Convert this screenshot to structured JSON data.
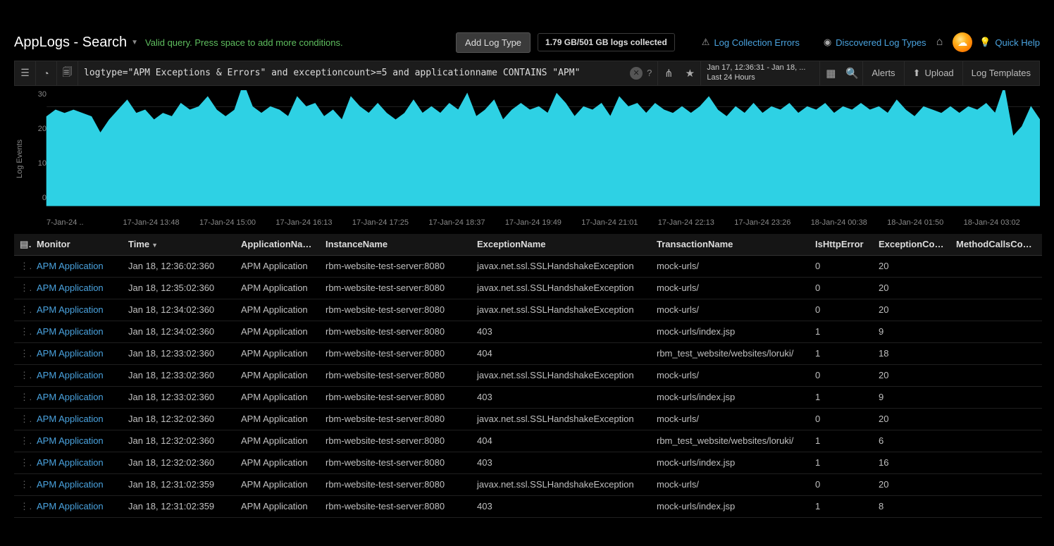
{
  "header": {
    "title": "AppLogs - Search",
    "query_hint": "Valid query. Press space to add more conditions.",
    "add_log_type": "Add Log Type",
    "logs_collected": "1.79 GB/501 GB logs collected",
    "links": {
      "collection_errors": "Log Collection Errors",
      "discovered_types": "Discovered Log Types",
      "quick_help": "Quick Help"
    }
  },
  "querybar": {
    "query": "logtype=\"APM Exceptions & Errors\" and exceptioncount>=5 and applicationname CONTAINS \"APM\"",
    "daterange_line1": "Jan 17, 12:36:31 - Jan 18, ...",
    "daterange_line2": "Last 24 Hours",
    "alerts": "Alerts",
    "upload": "Upload",
    "templates": "Log Templates"
  },
  "chart_data": {
    "type": "area",
    "ylabel": "Log Events",
    "ylim": [
      0,
      35
    ],
    "yticks": [
      30,
      20,
      10,
      0
    ],
    "xticks": [
      "7-Jan-24 ..",
      "17-Jan-24 13:48",
      "17-Jan-24 15:00",
      "17-Jan-24 16:13",
      "17-Jan-24 17:25",
      "17-Jan-24 18:37",
      "17-Jan-24 19:49",
      "17-Jan-24 21:01",
      "17-Jan-24 22:13",
      "17-Jan-24 23:26",
      "18-Jan-24 00:38",
      "18-Jan-24 01:50",
      "18-Jan-24 03:02"
    ],
    "values": [
      27,
      29,
      28,
      29,
      28,
      27,
      22,
      26,
      29,
      32,
      28,
      29,
      26,
      28,
      27,
      31,
      29,
      30,
      33,
      29,
      27,
      29,
      37,
      30,
      28,
      30,
      29,
      27,
      33,
      30,
      31,
      27,
      29,
      26,
      33,
      30,
      28,
      31,
      28,
      26,
      28,
      32,
      28,
      30,
      28,
      31,
      29,
      34,
      27,
      29,
      32,
      26,
      29,
      31,
      29,
      30,
      28,
      34,
      31,
      27,
      30,
      29,
      31,
      27,
      33,
      30,
      31,
      28,
      31,
      29,
      28,
      30,
      28,
      30,
      33,
      29,
      27,
      30,
      28,
      31,
      28,
      30,
      29,
      31,
      28,
      30,
      29,
      31,
      28,
      30,
      29,
      31,
      29,
      30,
      28,
      32,
      29,
      27,
      30,
      29,
      28,
      30,
      28,
      30,
      29,
      31,
      28,
      36,
      21,
      24,
      30,
      26
    ]
  },
  "table": {
    "columns": [
      "Monitor",
      "Time",
      "ApplicationName",
      "InstanceName",
      "ExceptionName",
      "TransactionName",
      "IsHttpError",
      "ExceptionCount",
      "MethodCallsCount"
    ],
    "sort_col": "Time",
    "rows": [
      {
        "monitor": "APM Application",
        "time": "Jan 18, 12:36:02:360",
        "app": "APM Application",
        "inst": "rbm-website-test-server:8080",
        "exc": "javax.net.ssl.SSLHandshakeException",
        "txn": "mock-urls/",
        "http": "0",
        "cnt": "20",
        "meth": ""
      },
      {
        "monitor": "APM Application",
        "time": "Jan 18, 12:35:02:360",
        "app": "APM Application",
        "inst": "rbm-website-test-server:8080",
        "exc": "javax.net.ssl.SSLHandshakeException",
        "txn": "mock-urls/",
        "http": "0",
        "cnt": "20",
        "meth": ""
      },
      {
        "monitor": "APM Application",
        "time": "Jan 18, 12:34:02:360",
        "app": "APM Application",
        "inst": "rbm-website-test-server:8080",
        "exc": "javax.net.ssl.SSLHandshakeException",
        "txn": "mock-urls/",
        "http": "0",
        "cnt": "20",
        "meth": ""
      },
      {
        "monitor": "APM Application",
        "time": "Jan 18, 12:34:02:360",
        "app": "APM Application",
        "inst": "rbm-website-test-server:8080",
        "exc": "403",
        "txn": "mock-urls/index.jsp",
        "http": "1",
        "cnt": "9",
        "meth": ""
      },
      {
        "monitor": "APM Application",
        "time": "Jan 18, 12:33:02:360",
        "app": "APM Application",
        "inst": "rbm-website-test-server:8080",
        "exc": "404",
        "txn": "rbm_test_website/websites/loruki/",
        "http": "1",
        "cnt": "18",
        "meth": ""
      },
      {
        "monitor": "APM Application",
        "time": "Jan 18, 12:33:02:360",
        "app": "APM Application",
        "inst": "rbm-website-test-server:8080",
        "exc": "javax.net.ssl.SSLHandshakeException",
        "txn": "mock-urls/",
        "http": "0",
        "cnt": "20",
        "meth": ""
      },
      {
        "monitor": "APM Application",
        "time": "Jan 18, 12:33:02:360",
        "app": "APM Application",
        "inst": "rbm-website-test-server:8080",
        "exc": "403",
        "txn": "mock-urls/index.jsp",
        "http": "1",
        "cnt": "9",
        "meth": ""
      },
      {
        "monitor": "APM Application",
        "time": "Jan 18, 12:32:02:360",
        "app": "APM Application",
        "inst": "rbm-website-test-server:8080",
        "exc": "javax.net.ssl.SSLHandshakeException",
        "txn": "mock-urls/",
        "http": "0",
        "cnt": "20",
        "meth": ""
      },
      {
        "monitor": "APM Application",
        "time": "Jan 18, 12:32:02:360",
        "app": "APM Application",
        "inst": "rbm-website-test-server:8080",
        "exc": "404",
        "txn": "rbm_test_website/websites/loruki/",
        "http": "1",
        "cnt": "6",
        "meth": ""
      },
      {
        "monitor": "APM Application",
        "time": "Jan 18, 12:32:02:360",
        "app": "APM Application",
        "inst": "rbm-website-test-server:8080",
        "exc": "403",
        "txn": "mock-urls/index.jsp",
        "http": "1",
        "cnt": "16",
        "meth": ""
      },
      {
        "monitor": "APM Application",
        "time": "Jan 18, 12:31:02:359",
        "app": "APM Application",
        "inst": "rbm-website-test-server:8080",
        "exc": "javax.net.ssl.SSLHandshakeException",
        "txn": "mock-urls/",
        "http": "0",
        "cnt": "20",
        "meth": ""
      },
      {
        "monitor": "APM Application",
        "time": "Jan 18, 12:31:02:359",
        "app": "APM Application",
        "inst": "rbm-website-test-server:8080",
        "exc": "403",
        "txn": "mock-urls/index.jsp",
        "http": "1",
        "cnt": "8",
        "meth": ""
      }
    ]
  }
}
